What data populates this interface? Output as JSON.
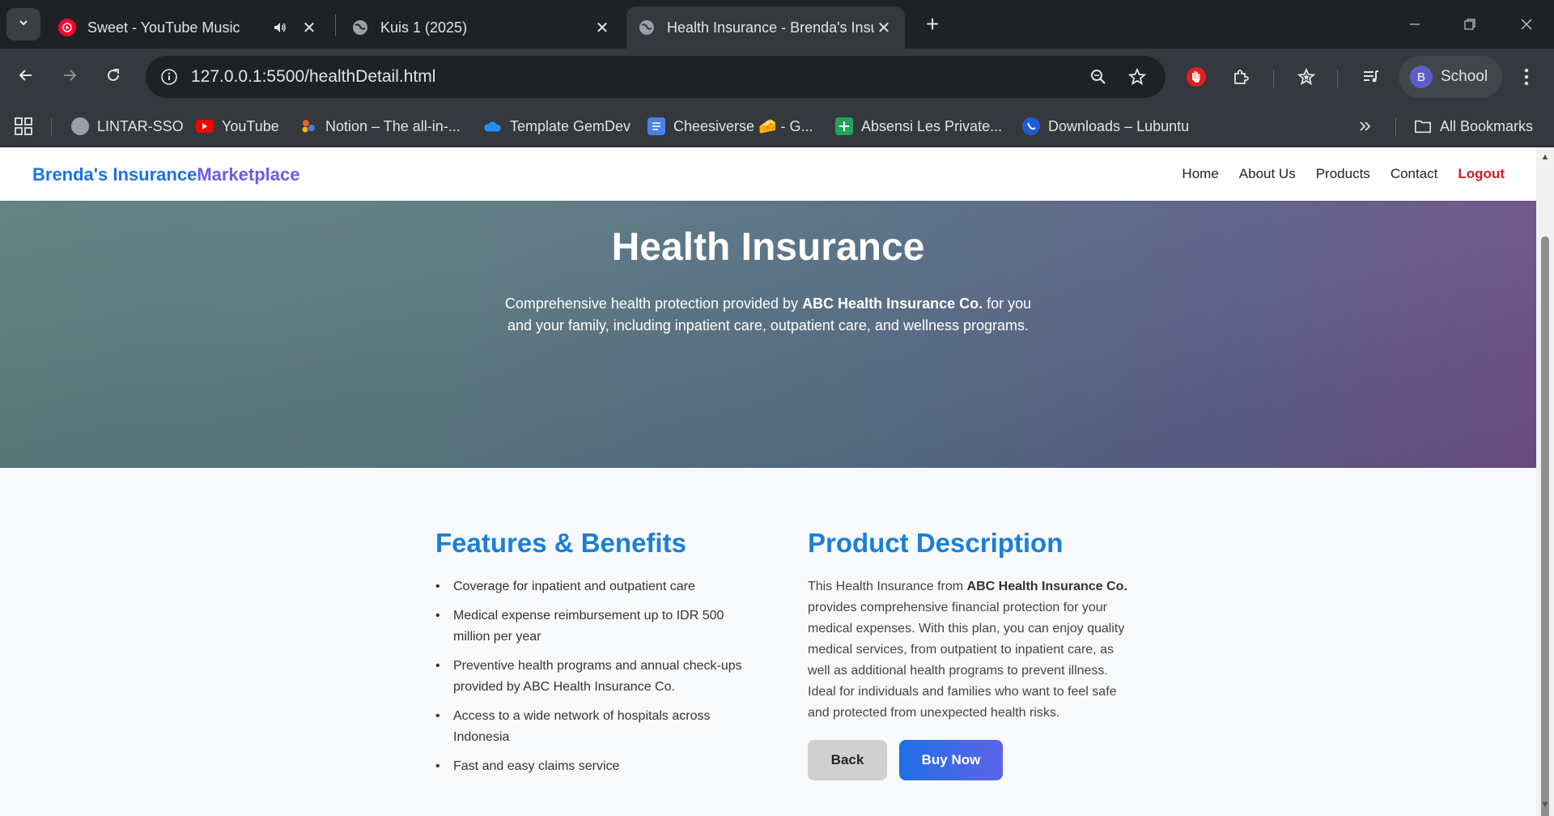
{
  "browser": {
    "tabs": [
      {
        "title": "Sweet - YouTube Music",
        "audio": true
      },
      {
        "title": "Kuis 1 (2025)"
      },
      {
        "title": "Health Insurance - Brenda's Insu",
        "active": true
      }
    ],
    "url": "127.0.0.1:5500/healthDetail.html",
    "profile": {
      "initial": "B",
      "name": "School"
    },
    "bookmarks": [
      {
        "label": "LINTAR-SSO",
        "icon": "globe-icon"
      },
      {
        "label": "YouTube",
        "icon": "youtube-icon"
      },
      {
        "label": "Notion – The all-in-...",
        "icon": "notion-icon"
      },
      {
        "label": "Template GemDev",
        "icon": "onedrive-icon"
      },
      {
        "label": "Cheesiverse 🧀 - G...",
        "icon": "docs-icon"
      },
      {
        "label": "Absensi Les Private...",
        "icon": "sheets-icon"
      },
      {
        "label": "Downloads – Lubuntu",
        "icon": "lubuntu-icon"
      }
    ],
    "all_bookmarks": "All Bookmarks"
  },
  "site": {
    "brand_part1": "Brenda's Insurance",
    "brand_part2": "Marketplace",
    "nav": [
      "Home",
      "About Us",
      "Products",
      "Contact",
      "Logout"
    ]
  },
  "hero": {
    "title": "Health Insurance",
    "text_before": "Comprehensive health protection provided by ",
    "company": "ABC Health Insurance Co.",
    "text_after": " for you and your family, including inpatient care, outpatient care, and wellness programs."
  },
  "features": {
    "title": "Features & Benefits",
    "items": [
      "Coverage for inpatient and outpatient care",
      "Medical expense reimbursement up to IDR 500 million per year",
      "Preventive health programs and annual check-ups provided by ABC Health Insurance Co.",
      "Access to a wide network of hospitals across Indonesia",
      "Fast and easy claims service"
    ]
  },
  "description": {
    "title": "Product Description",
    "text_before": "This Health Insurance from ",
    "company": "ABC Health Insurance Co.",
    "text_after": " provides comprehensive financial protection for your medical expenses. With this plan, you can enjoy quality medical services, from outpatient to inpatient care, as well as additional health programs to prevent illness. Ideal for individuals and families who want to feel safe and protected from unexpected health risks."
  },
  "buttons": {
    "back": "Back",
    "buy": "Buy Now"
  },
  "colors": {
    "accent": "#1a7fd6",
    "brand_secondary": "#6c5ce7",
    "logout": "#d11a2a"
  }
}
